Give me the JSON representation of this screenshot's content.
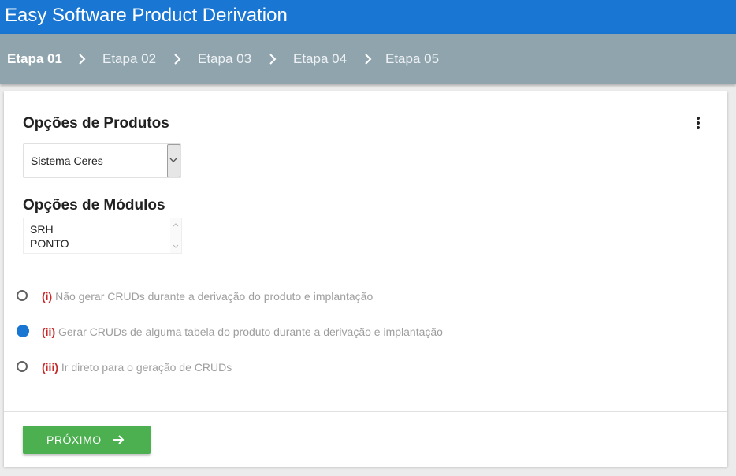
{
  "app": {
    "title": "Easy Software Product Derivation"
  },
  "stepper": {
    "steps": [
      "Etapa 01",
      "Etapa 02",
      "Etapa 03",
      "Etapa 04",
      "Etapa 05"
    ],
    "active_index": 0
  },
  "products": {
    "heading": "Opções de Produtos",
    "selected": "Sistema Ceres"
  },
  "modules": {
    "heading": "Opções de Módulos",
    "options": [
      "SRH",
      "PONTO"
    ]
  },
  "options": [
    {
      "num": "(i)",
      "text": "Não gerar CRUDs durante a derivação do produto e implantação",
      "checked": false
    },
    {
      "num": "(ii)",
      "text": "Gerar CRUDs de alguma tabela do produto durante a derivação e implantação",
      "checked": true
    },
    {
      "num": "(iii)",
      "text": "Ir direto para o geração de CRUDs",
      "checked": false
    }
  ],
  "actions": {
    "next_label": "PRÓXIMO"
  },
  "colors": {
    "appbar": "#1976d2",
    "stepper": "#90a4ae",
    "primary_button": "#4caf50",
    "radio_checked": "#1976d2",
    "option_number": "#c62828"
  }
}
